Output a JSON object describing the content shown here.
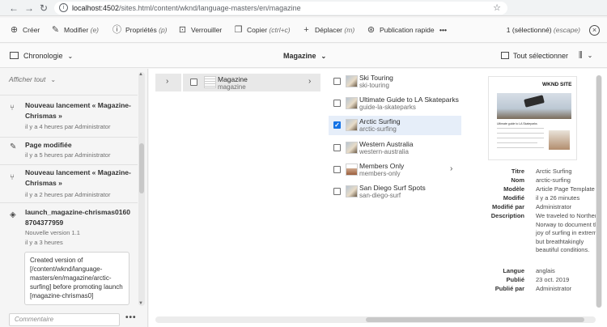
{
  "browser": {
    "url_host": "localhost:4502",
    "url_path": "/sites.html/content/wknd/language-masters/en/magazine",
    "back_glyph": "←",
    "forward_glyph": "→",
    "reload_glyph": "↻",
    "star_glyph": "☆"
  },
  "actions": {
    "create": "Créer",
    "edit": "Modifier",
    "edit_kbd": "(e)",
    "properties": "Propriétés",
    "properties_kbd": "(p)",
    "lock": "Verrouiller",
    "copy": "Copier",
    "copy_kbd": "(ctrl+c)",
    "move": "Déplacer",
    "move_kbd": "(m)",
    "quick_publish": "Publication rapide",
    "more": "•••",
    "selection": "1 (sélectionné)",
    "selection_kbd": "(escape)"
  },
  "viewbar": {
    "timeline": "Chronologie",
    "breadcrumb": "Magazine",
    "select_all": "Tout sélectionner"
  },
  "timeline": {
    "filter": "Afficher tout",
    "items": [
      {
        "title": "Nouveau lancement « Magazine-Chrismas »",
        "meta": "il y a 4 heures par Administrator",
        "icon": "⑂"
      },
      {
        "title": "Page modifiée",
        "meta": "il y a 5 heures par Administrator",
        "icon": "✎"
      },
      {
        "title": "Nouveau lancement « Magazine-Chrismas »",
        "meta": "il y a 2 heures par Administrator",
        "icon": "⑂"
      },
      {
        "title": "launch_magazine-chrismas01608704377959",
        "meta": "Nouvelle version 1.1",
        "meta2": "il y a 3 heures",
        "icon": "◈"
      }
    ],
    "comment_text": "Created version of [/content/wknd/language-masters/en/magazine/arctic-surfing] before promoting launch [magazine-chrismas0]",
    "comment_placeholder": "Commentaire",
    "more": "•••"
  },
  "columns": {
    "root_arrow": "›",
    "folder": {
      "title": "Magazine",
      "name": "magazine"
    },
    "pages": [
      {
        "title": "Ski Touring",
        "name": "ski-touring",
        "checked": false
      },
      {
        "title": "Ultimate Guide to LA Skateparks",
        "name": "guide-la-skateparks",
        "checked": false
      },
      {
        "title": "Arctic Surfing",
        "name": "arctic-surfing",
        "checked": true
      },
      {
        "title": "Western Australia",
        "name": "western-australia",
        "checked": false
      },
      {
        "title": "Members Only",
        "name": "members-only",
        "checked": false
      },
      {
        "title": "San Diego Surf Spots",
        "name": "san-diego-surf",
        "checked": false
      }
    ]
  },
  "preview": {
    "brand": "WKND SITE",
    "caption": "Ultimate guide to LA Skateparks",
    "props": [
      {
        "k": "Titre",
        "v": "Arctic Surfing"
      },
      {
        "k": "Nom",
        "v": "arctic-surfing"
      },
      {
        "k": "Modèle",
        "v": "Article Page Template"
      },
      {
        "k": "Modifié",
        "v": "il y a 26 minutes"
      },
      {
        "k": "Modifié par",
        "v": "Administrator"
      },
      {
        "k": "Description",
        "v": "We traveled to Northern Norway to document the joy of surfing in extreme, but breathtakingly beautiful conditions."
      },
      {
        "k": "Langue",
        "v": "anglais"
      },
      {
        "k": "Publié",
        "v": "23 oct. 2019"
      },
      {
        "k": "Publié par",
        "v": "Administrator"
      }
    ]
  }
}
